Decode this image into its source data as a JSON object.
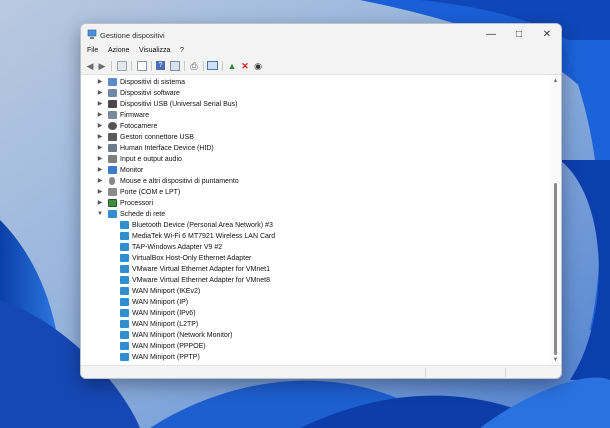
{
  "window": {
    "title": "Gestione dispositivi"
  },
  "menu": [
    "File",
    "Azione",
    "Visualizza",
    "?"
  ],
  "toolbar": [
    "back-icon",
    "forward-icon",
    "show-hide-icon",
    "properties-icon",
    "help-icon",
    "list-view-icon",
    "print-icon",
    "scan-hardware-icon",
    "enable-device-icon",
    "uninstall-icon",
    "update-driver-icon"
  ],
  "tree": {
    "categories": [
      {
        "label": "Dispositivi di sistema",
        "icon": "system-devices-icon",
        "color": "#5b8bc9"
      },
      {
        "label": "Dispositivi software",
        "icon": "software-devices-icon",
        "color": "#6f8aa8"
      },
      {
        "label": "Dispositivi USB (Universal Serial Bus)",
        "icon": "usb-icon",
        "color": "#4a4a4a"
      },
      {
        "label": "Firmware",
        "icon": "firmware-icon",
        "color": "#7a8a99"
      },
      {
        "label": "Fotocamere",
        "icon": "camera-icon",
        "color": "#555555"
      },
      {
        "label": "Gestori connettore USB",
        "icon": "usb-connector-icon",
        "color": "#5a5a5a"
      },
      {
        "label": "Human Interface Device (HID)",
        "icon": "hid-icon",
        "color": "#6b7b8c"
      },
      {
        "label": "Input e output audio",
        "icon": "audio-icon",
        "color": "#7f7f7f"
      },
      {
        "label": "Monitor",
        "icon": "monitor-icon",
        "color": "#3b7bd0"
      },
      {
        "label": "Mouse e altri dispositivi di puntamento",
        "icon": "mouse-icon",
        "color": "#8a8a8a"
      },
      {
        "label": "Porte (COM e LPT)",
        "icon": "ports-icon",
        "color": "#8c8c8c"
      },
      {
        "label": "Processori",
        "icon": "processor-icon",
        "color": "#3f8f3f"
      },
      {
        "label": "Schede di rete",
        "icon": "network-adapters-icon",
        "color": "#2f8fcf",
        "expanded": true
      }
    ],
    "network_adapters": [
      "Bluetooth Device (Personal Area Network) #3",
      "MediaTek Wi-Fi 6 MT7921 Wireless LAN Card",
      "TAP-Windows Adapter V9 #2",
      "VirtualBox Host-Only Ethernet Adapter",
      "VMware Virtual Ethernet Adapter for VMnet1",
      "VMware Virtual Ethernet Adapter for VMnet8",
      "WAN Miniport (IKEv2)",
      "WAN Miniport (IP)",
      "WAN Miniport (IPv6)",
      "WAN Miniport (L2TP)",
      "WAN Miniport (Network Monitor)",
      "WAN Miniport (PPPOE)",
      "WAN Miniport (PPTP)"
    ]
  },
  "colors": {
    "accent": "#2f8fcf",
    "wallpaper": "#1f4fb8"
  }
}
